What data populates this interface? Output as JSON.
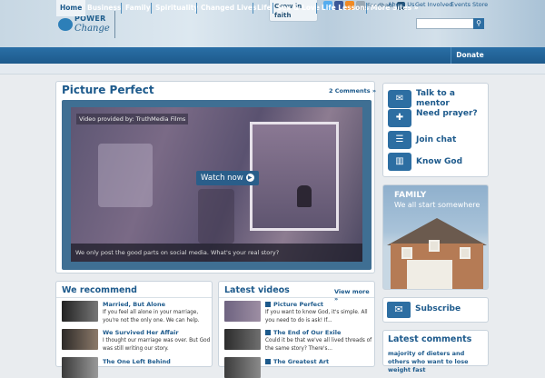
{
  "header": {
    "logo_line1": "POWER",
    "logo_line2": "Change",
    "tagline": "Grow in faith",
    "feedback": "Feedback",
    "search_placeholder": ""
  },
  "nav": {
    "items": [
      "Home",
      "Business",
      "Family",
      "Spirituality",
      "Changed Lives",
      "Life",
      "Sex & Love",
      "Life Lessons",
      "More Sites »"
    ],
    "donate": "Donate"
  },
  "subnav": [
    "About Us",
    "Get Involved",
    "Events",
    "Store"
  ],
  "featured": {
    "title": "Picture Perfect",
    "comments": "2 Comments »",
    "provided_by": "Video provided by: TruthMedia Films",
    "watch_label": "Watch now",
    "caption": "We only post the good parts on social media. What's your real story?"
  },
  "sidebar": {
    "items": [
      {
        "label": "Talk to a mentor",
        "icon": "chat-bubble-icon"
      },
      {
        "label": "Need prayer?",
        "icon": "prayer-icon"
      },
      {
        "label": "Join chat",
        "icon": "chat-icon"
      },
      {
        "label": "Know God",
        "icon": "book-icon"
      }
    ],
    "family_title": "FAMILY",
    "family_subtitle": "We all start somewhere",
    "subscribe": "Subscribe",
    "latest_comments_title": "Latest comments",
    "latest_comment": "majority of dieters and others who want to lose weight fast"
  },
  "recommend": {
    "title": "We recommend",
    "items": [
      {
        "title": "Married, But Alone",
        "text": "If you feel all alone in your marriage, you're not the only one. We can help."
      },
      {
        "title": "We Survived Her Affair",
        "text": "I thought our marriage was over. But God was still writing our story."
      },
      {
        "title": "The One Left Behind",
        "text": ""
      }
    ]
  },
  "videos": {
    "title": "Latest videos",
    "more": "View more »",
    "items": [
      {
        "title": "Picture Perfect",
        "text": "If you want to know God, it's simple. All you need to do is ask! If..."
      },
      {
        "title": "The End of Our Exile",
        "text": "Could it be that we've all lived threads of the same story? There's..."
      },
      {
        "title": "The Greatest Art",
        "text": ""
      }
    ]
  },
  "colors": {
    "brand": "#1d5a8c",
    "nav": "#2a6fa6"
  }
}
